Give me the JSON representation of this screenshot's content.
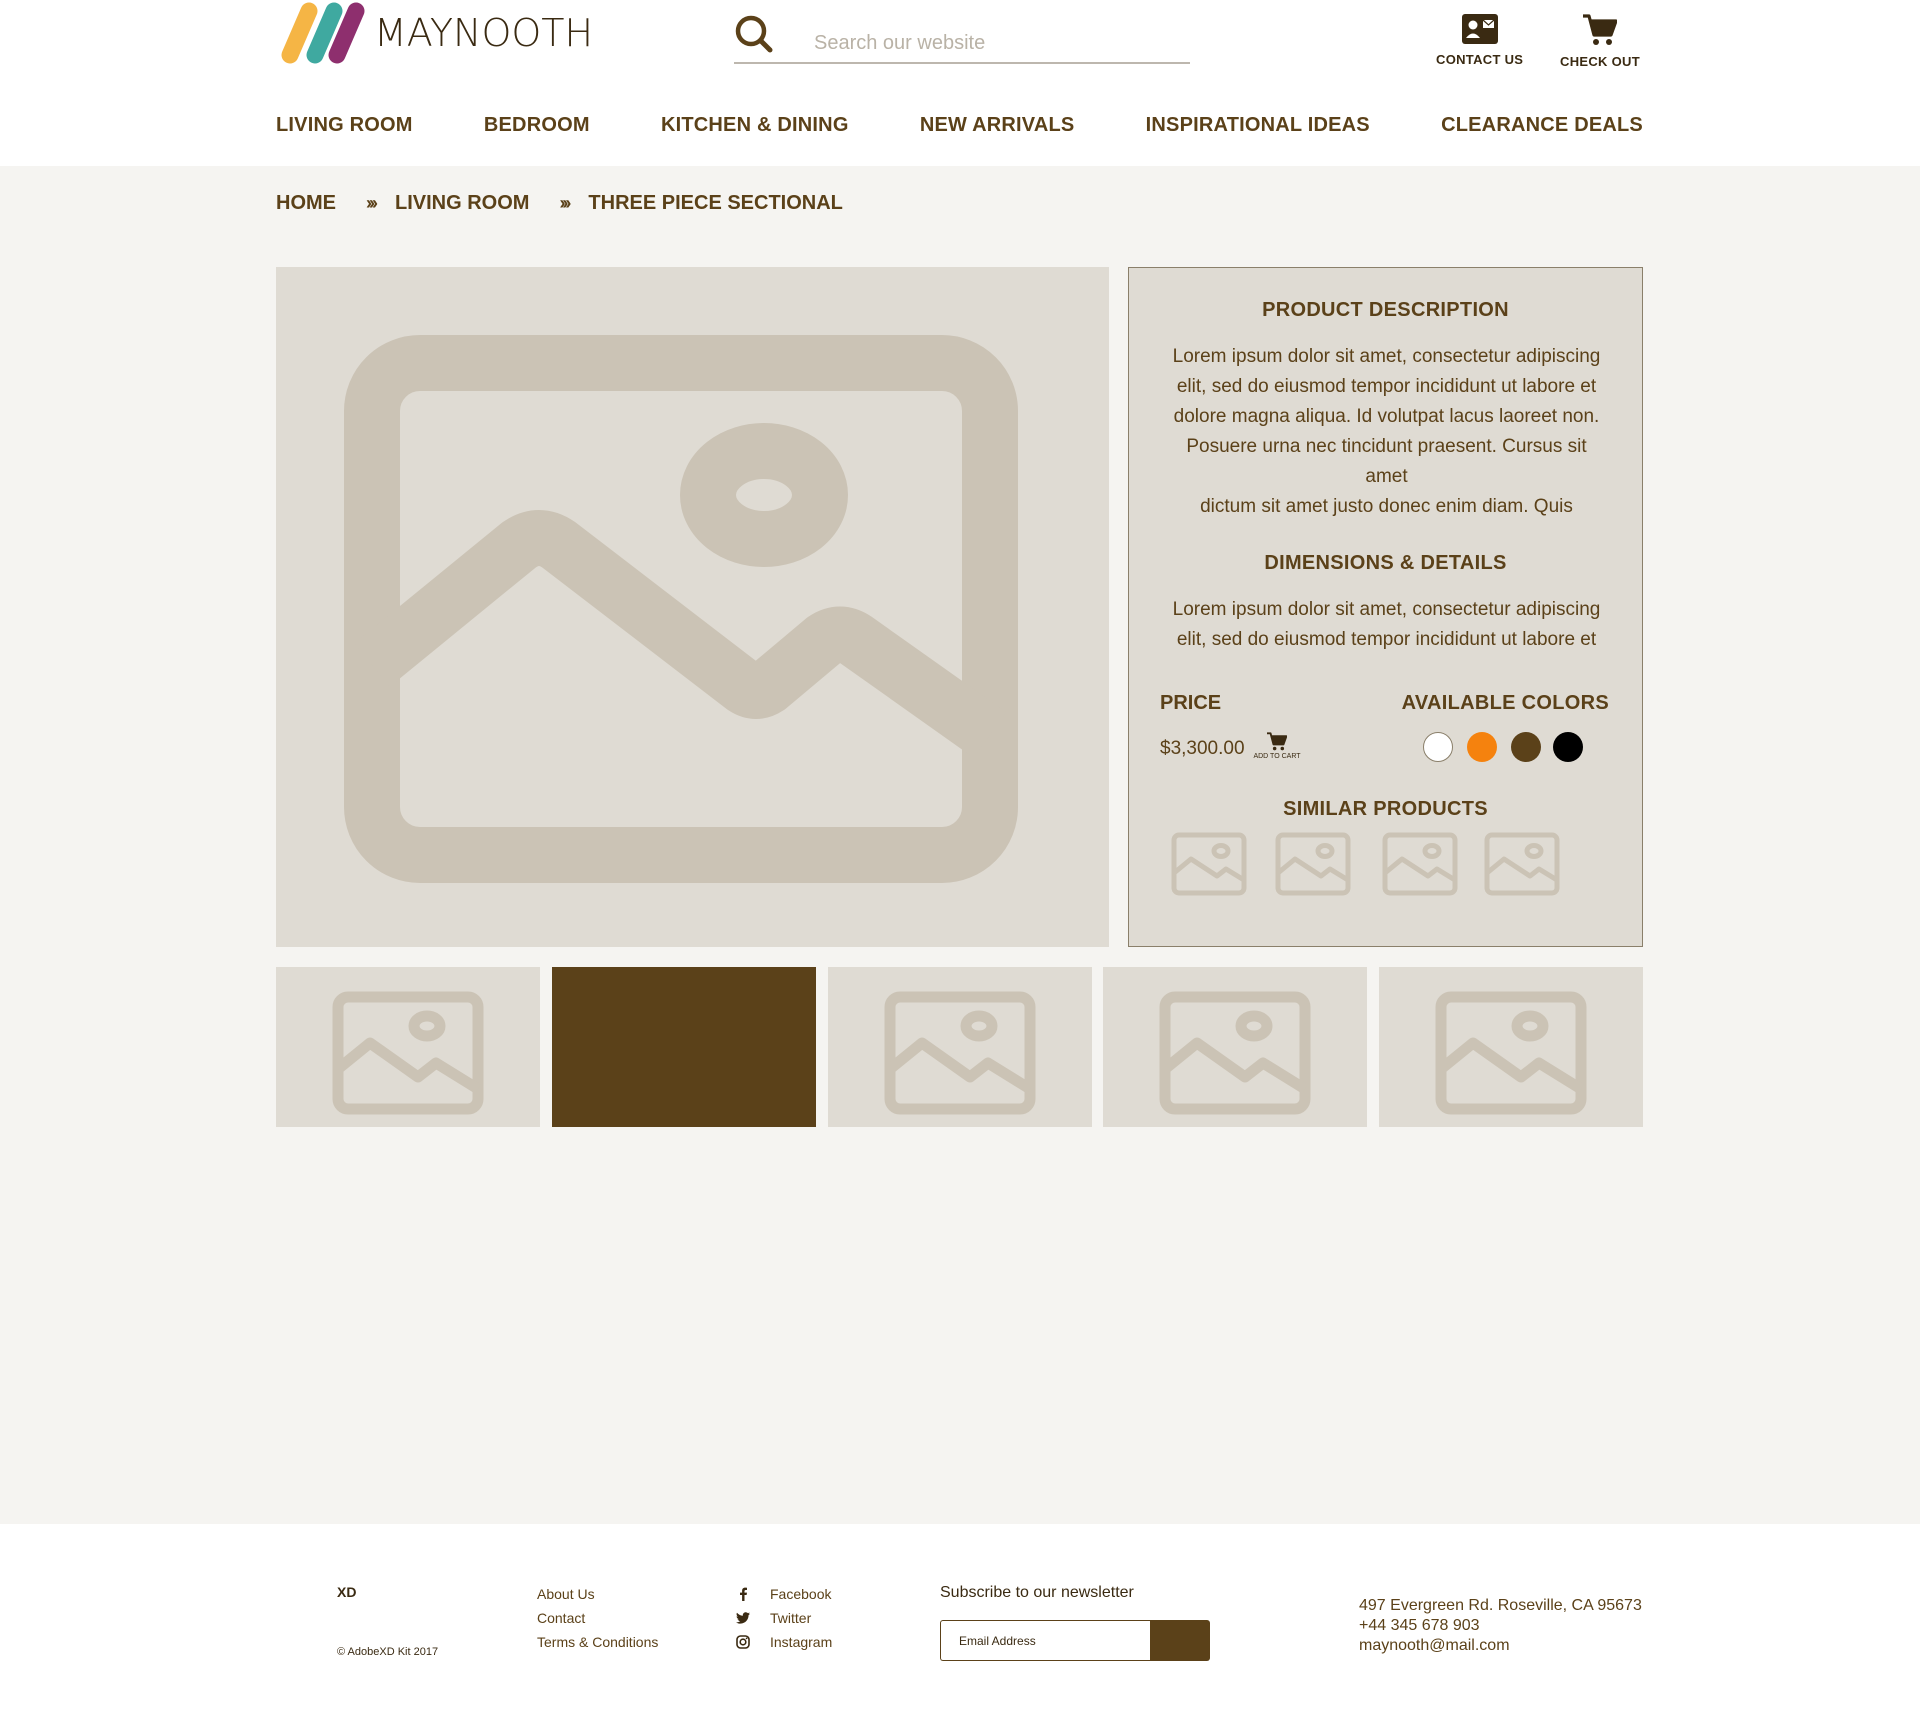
{
  "header": {
    "logo_text": "MAYNOOTH",
    "search_placeholder": "Search our website",
    "contact_label": "CONTACT  US",
    "checkout_label": "CHECK OUT"
  },
  "nav": [
    "LIVING ROOM",
    "BEDROOM",
    "KITCHEN & DINING",
    "NEW ARRIVALS",
    "INSPIRATIONAL IDEAS",
    "CLEARANCE DEALS"
  ],
  "breadcrumb": {
    "items": [
      "HOME",
      "LIVING ROOM",
      "THREE PIECE SECTIONAL"
    ],
    "separator": "›››"
  },
  "product": {
    "description_title": "PRODUCT  DESCRIPTION",
    "description_lines": [
      "Lorem ipsum dolor sit amet, consectetur adipiscing",
      "elit, sed do eiusmod tempor incididunt ut labore et",
      "dolore magna aliqua. Id volutpat lacus laoreet non.",
      "Posuere urna nec tincidunt praesent. Cursus sit",
      "amet",
      "dictum sit amet justo donec enim diam. Quis"
    ],
    "dimensions_title": "DIMENSIONS & DETAILS",
    "dimensions_lines": [
      "Lorem ipsum dolor sit amet, consectetur adipiscing",
      "elit, sed do eiusmod tempor incididunt ut labore et"
    ],
    "price_label": "PRICE",
    "price": "$3,300.00",
    "add_to_cart_label": "ADD TO CART",
    "colors_label": "AVAILABLE  COLORS",
    "colors": [
      "#ffffff",
      "#f5820e",
      "#5b4119",
      "#000000"
    ],
    "similar_label": "SIMILAR  PRODUCTS",
    "similar_count_icons": [
      "image-placeholder-icon",
      "image-placeholder-icon",
      "image-placeholder-icon",
      "image-placeholder-icon"
    ]
  },
  "thumbnails_selected_index": 1,
  "footer": {
    "brand": "XD",
    "copyright": "© AdobeXD Kit 2017",
    "links": [
      "About Us",
      "Contact",
      "Terms & Conditions"
    ],
    "social": [
      {
        "icon": "facebook-icon",
        "label": "Facebook"
      },
      {
        "icon": "twitter-icon",
        "label": "Twitter"
      },
      {
        "icon": "instagram-icon",
        "label": "Instagram"
      }
    ],
    "newsletter_title": "Subscribe to our newsletter",
    "email_placeholder": "Email Address",
    "address": "497 Evergreen Rd. Roseville, CA 95673",
    "phone": "+44 345 678 903",
    "email": "maynooth@mail.com"
  },
  "colors": {
    "brand_brown": "#5b4119",
    "placeholder_bg": "#dfdbd3",
    "placeholder_fg": "#cbc3b5",
    "page_bg": "#f5f4f1"
  }
}
